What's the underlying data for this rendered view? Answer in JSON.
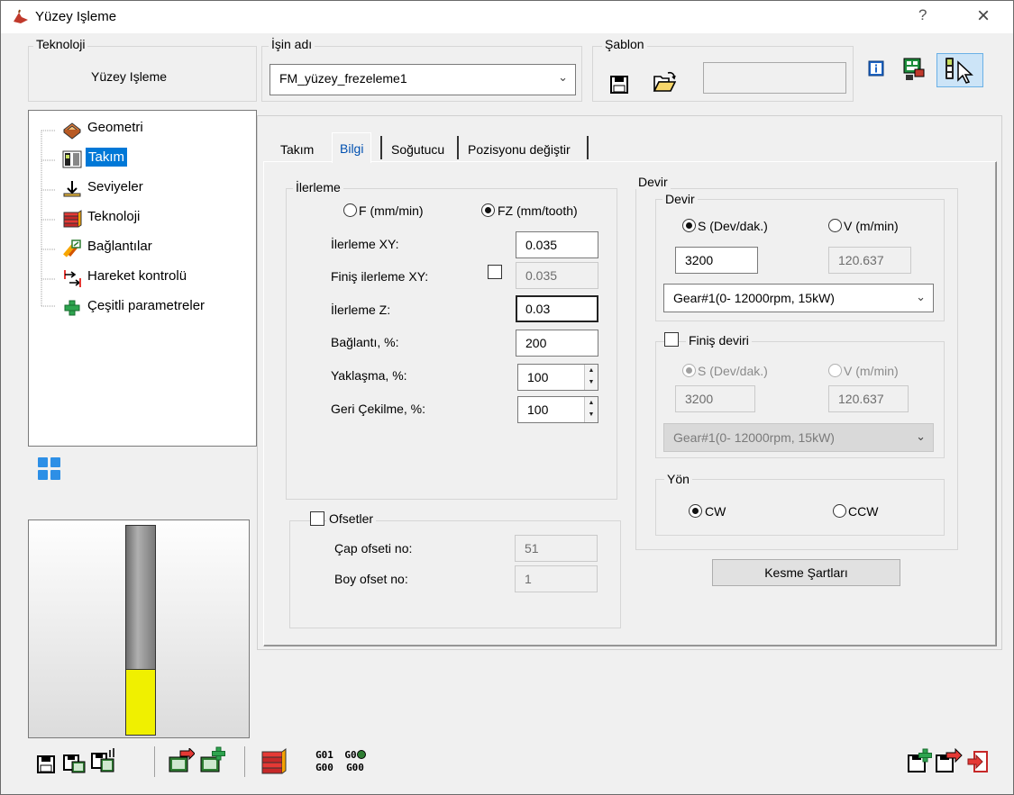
{
  "window": {
    "title": "Yüzey Işleme",
    "help_label": "?",
    "close_label": "×"
  },
  "header": {
    "technology_label": "Teknoloji",
    "technology_value": "Yüzey Işleme",
    "job_name_label": "İşin adı",
    "job_name_value": "FM_yüzey_frezeleme1",
    "template_label": "Şablon",
    "template_value": ""
  },
  "tree": {
    "items": [
      {
        "label": "Geometri",
        "icon": "geometry-icon"
      },
      {
        "label": "Takım",
        "icon": "tool-icon",
        "selected": true
      },
      {
        "label": "Seviyeler",
        "icon": "levels-icon"
      },
      {
        "label": "Teknoloji",
        "icon": "technology-icon"
      },
      {
        "label": "Bağlantılar",
        "icon": "links-icon"
      },
      {
        "label": "Hareket kontrolü",
        "icon": "motion-control-icon"
      },
      {
        "label": "Çeşitli parametreler",
        "icon": "plus-icon"
      }
    ],
    "selection_color": "#0078d7"
  },
  "tabs": [
    {
      "label": "Takım"
    },
    {
      "label": "Bilgi",
      "active": true
    },
    {
      "label": "Soğutucu"
    },
    {
      "label": "Pozisyonu değiştir"
    }
  ],
  "feed": {
    "group_label": "İlerleme",
    "radio_f": "F (mm/min)",
    "radio_fz": "FZ (mm/tooth)",
    "selected": "FZ (mm/tooth)",
    "fields": [
      {
        "label": "İlerleme XY:",
        "value": "0.035",
        "enabled": true
      },
      {
        "label": "Finiş ilerleme XY:",
        "value": "0.035",
        "enabled": false,
        "checked": false
      },
      {
        "label": "İlerleme Z:",
        "value": "0.03",
        "enabled": true,
        "focused": true
      },
      {
        "label": "Bağlantı, %:",
        "value": "200",
        "enabled": true
      },
      {
        "label": "Yaklaşma, %:",
        "value": "100",
        "enabled": true,
        "spinner": true
      },
      {
        "label": "Geri Çekilme, %:",
        "value": "100",
        "enabled": true,
        "spinner": true
      }
    ]
  },
  "offsets": {
    "label": "Ofsetler",
    "checked": false,
    "diameter_label": "Çap ofseti no:",
    "diameter_value": "51",
    "length_label": "Boy ofset no:",
    "length_value": "1"
  },
  "spindle": {
    "group_label": "Devir",
    "sub_label": "Devir",
    "radio_s": "S (Dev/dak.)",
    "radio_v": "V (m/min)",
    "selected": "S (Dev/dak.)",
    "s_value": "3200",
    "v_value": "120.637",
    "gear": "Gear#1(0- 12000rpm, 15kW)",
    "finish_label": "Finiş deviri",
    "finish_checked": false,
    "finish_s_radio": "S (Dev/dak.)",
    "finish_v_radio": "V (m/min)",
    "finish_s_value": "3200",
    "finish_v_value": "120.637",
    "finish_gear": "Gear#1(0- 12000rpm, 15kW)",
    "direction_label": "Yön",
    "cw_label": "CW",
    "ccw_label": "CCW",
    "direction_selected": "CW"
  },
  "cutting_conditions_button": "Kesme Şartları",
  "toolbar": {
    "gcode_g01": "G01",
    "gcode_g00": "G00",
    "gcode_g0": "G0",
    "gcode_g00b": "G00"
  },
  "colors": {
    "accent": "#0078d7",
    "tool_shank": "#8c8c8c",
    "tool_flute": "#f0f000"
  }
}
